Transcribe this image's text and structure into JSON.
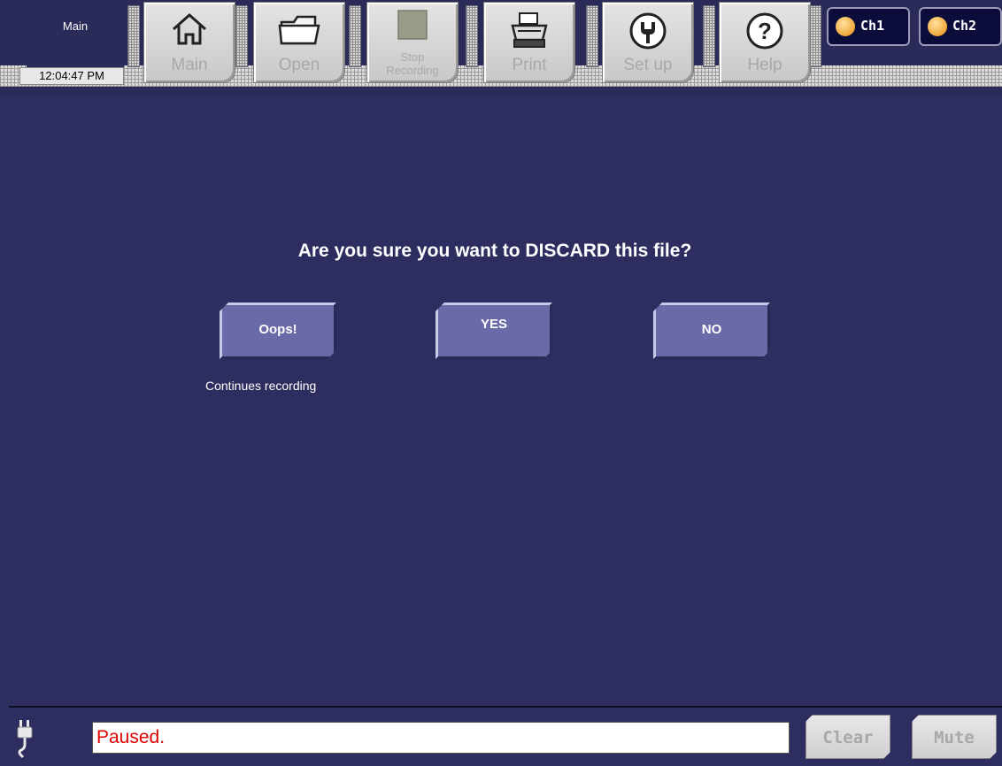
{
  "header": {
    "screen_label": "Main",
    "clock": "12:04:47 PM"
  },
  "toolbar": {
    "main_label": "Main",
    "open_label": "Open",
    "stop_line1": "Stop",
    "stop_line2": "Recording",
    "print_label": "Print",
    "setup_label": "Set up",
    "help_label": "Help"
  },
  "channels": {
    "ch1_label": "Ch1",
    "ch2_label": "Ch2",
    "led_color": "#f0a838"
  },
  "dialog": {
    "prompt": "Are you sure you want to DISCARD this file?",
    "oops_label": "Oops!",
    "oops_note": "Continues recording",
    "yes_label": "YES",
    "no_label": "NO"
  },
  "statusbar": {
    "status_text": "Paused.",
    "clear_label": "Clear",
    "mute_label": "Mute"
  },
  "colors": {
    "background": "#2d2d5f",
    "dialog_button": "#6a6aa8",
    "status_text": "#e00000",
    "disabled_text": "#a8a8a8"
  }
}
